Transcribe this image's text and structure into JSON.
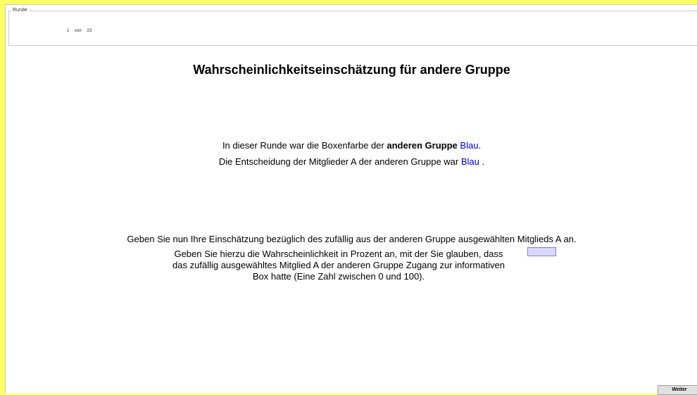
{
  "header": {
    "legend": "Runde",
    "round_current": "1",
    "round_separator": "von",
    "round_total": "23"
  },
  "main": {
    "title": "Wahrscheinlichkeitseinschätzung für andere Gruppe",
    "info_line1": {
      "prefix": "In dieser Runde war die Boxenfarbe der ",
      "bold": "anderen Gruppe",
      "color_value": "Blau",
      "suffix": "."
    },
    "info_line2": {
      "prefix": "Die Entscheidung der Mitglieder A der anderen Gruppe war ",
      "color_value": "Blau",
      "suffix": " ."
    },
    "instruction": "Geben Sie nun Ihre Einschätzung bezüglich des zufällig aus der anderen Gruppe ausgewählten Mitglieds A an.",
    "question_lines": [
      "Geben Sie hierzu die Wahrscheinlichkeit in Prozent an, mit der Sie glauben, dass",
      "das zufällig ausgewähltes Mitglied A der anderen Gruppe Zugang zur informativen",
      "Box hatte (Eine Zahl zwischen 0 und 100)."
    ],
    "probability_value": ""
  },
  "footer": {
    "continue_label": "Weiter"
  },
  "colors": {
    "border_yellow": "#ffff66",
    "value_blue": "#0000cc",
    "input_background": "#d8d8ff"
  }
}
